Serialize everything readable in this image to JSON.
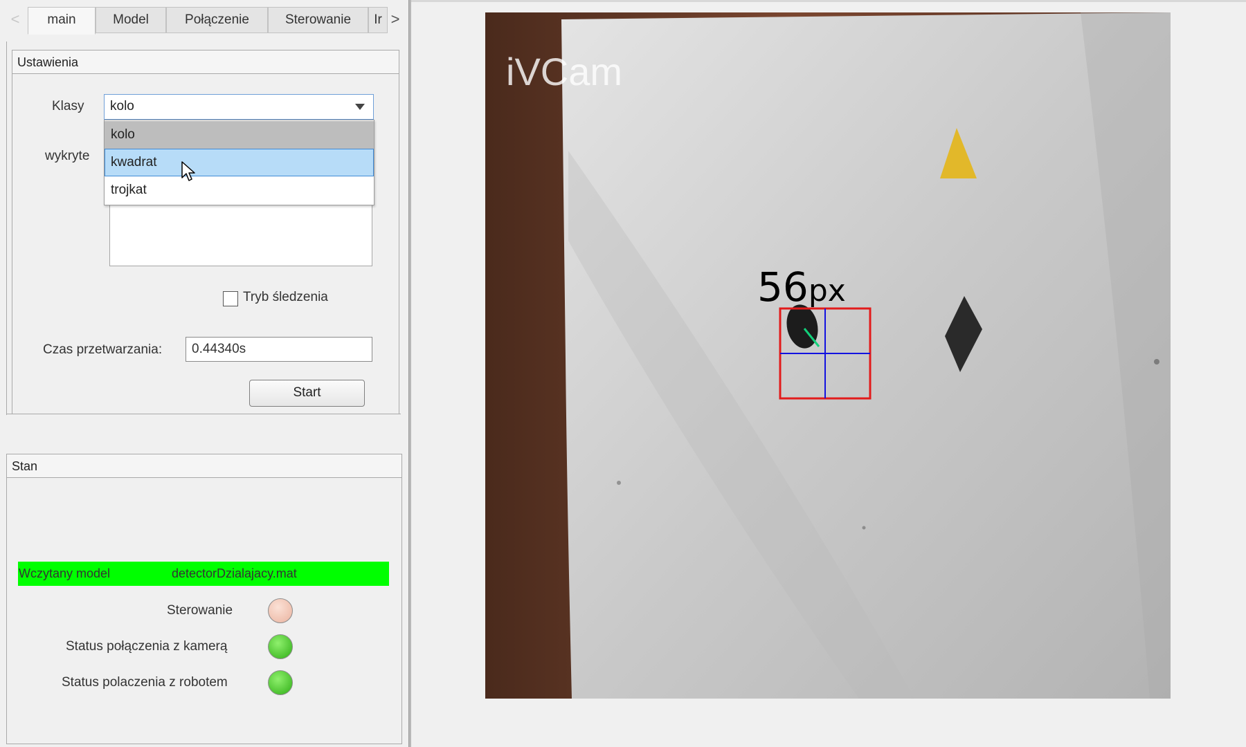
{
  "tabs": {
    "items": [
      "main",
      "Model",
      "Połączenie",
      "Sterowanie",
      "Ir"
    ],
    "active_index": 0,
    "prev_arrow": "<",
    "next_arrow": ">"
  },
  "settings": {
    "title": "Ustawienia",
    "classes_label": "Klasy",
    "classes_value": "kolo",
    "classes_options": [
      "kolo",
      "kwadrat",
      "trojkat"
    ],
    "detected_label": "wykryte",
    "tracking_label": "Tryb śledzenia",
    "tracking_checked": false,
    "processing_time_label": "Czas przetwarzania:",
    "processing_time_value": "0.44340s",
    "start_label": "Start"
  },
  "status": {
    "title": "Stan",
    "model_label": "Wczytany model",
    "model_value": "detectorDzialajacy.mat",
    "model_bar_color": "#00ff00",
    "control_label": "Sterowanie",
    "control_lamp_color": "#f2c4b3",
    "camera_label": "Status połączenia z kamerą",
    "camera_lamp_color": "#39c11f",
    "robot_label": "Status polaczenia z robotem",
    "robot_lamp_color": "#39c11f"
  },
  "camera_view": {
    "watermark": "iVCam",
    "measurement_value": "56",
    "measurement_unit": "px",
    "bbox_color": "#e21b1b",
    "crosshair_color": "#1212e0",
    "orientation_color": "#12d07a"
  }
}
